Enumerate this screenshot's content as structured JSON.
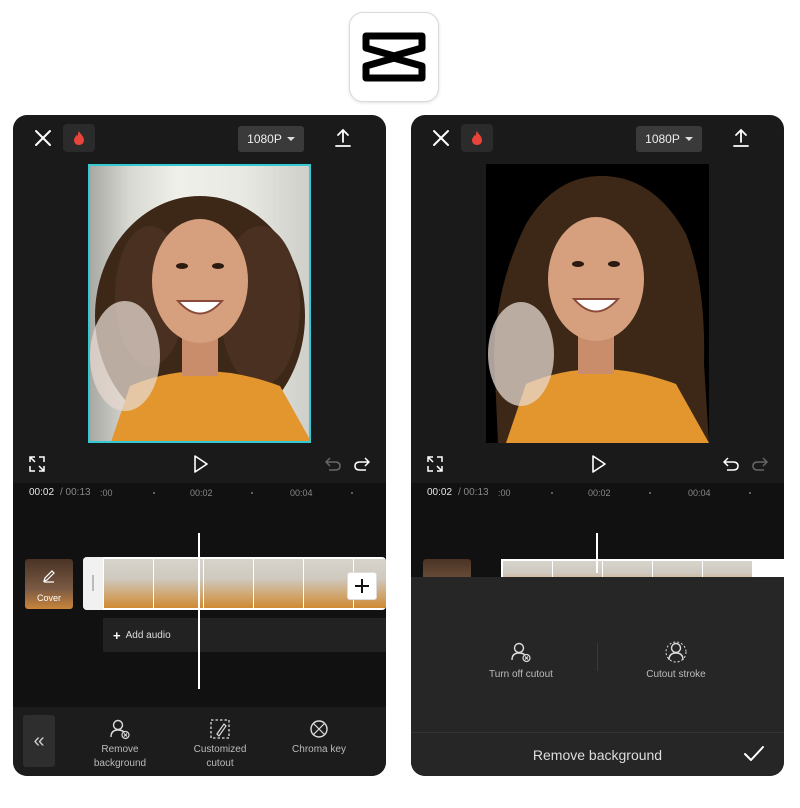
{
  "logo": {
    "icon": "capcut-logo-icon"
  },
  "left_phone": {
    "topbar": {
      "resolution": "1080P"
    },
    "timeline": {
      "current_time": "00:02",
      "total_time": "/ 00:13",
      "ruler_labels": [
        ":00",
        "00:02",
        "00:04"
      ],
      "cover_label": "Cover",
      "add_audio_label": "Add audio"
    },
    "toolbar": {
      "back_icon": "«",
      "tools": [
        {
          "label": "Remove background",
          "icon": "remove-background-icon"
        },
        {
          "label": "Customized cutout",
          "icon": "customized-cutout-icon"
        },
        {
          "label": "Chroma key",
          "icon": "chroma-key-icon"
        }
      ]
    }
  },
  "right_phone": {
    "topbar": {
      "resolution": "1080P"
    },
    "timeline": {
      "current_time": "00:02",
      "total_time": "/ 00:13",
      "ruler_labels": [
        ":00",
        "00:02",
        "00:04"
      ]
    },
    "panel": {
      "options": [
        {
          "label": "Turn off cutout",
          "icon": "turn-off-cutout-icon"
        },
        {
          "label": "Cutout stroke",
          "icon": "cutout-stroke-icon"
        }
      ],
      "title": "Remove background"
    }
  },
  "colors": {
    "selection": "#35c9d4",
    "background": "#1a1a1a",
    "fire": "#e8443a"
  }
}
